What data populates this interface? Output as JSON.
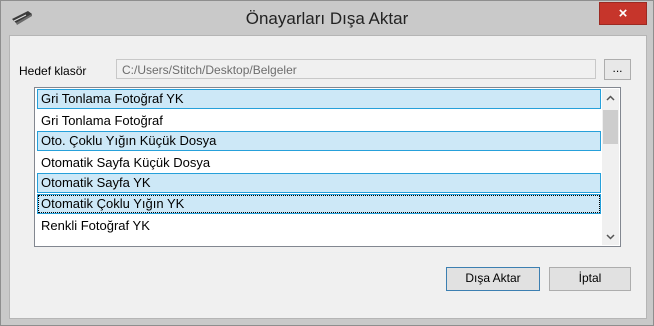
{
  "window": {
    "title": "Önayarları Dışa Aktar",
    "close_label": "×",
    "accent_close": "#c6352b"
  },
  "folder": {
    "label": "Hedef klasör",
    "path": "C:/Users/Stitch/Desktop/Belgeler",
    "browse_label": "..."
  },
  "presets": {
    "items": [
      {
        "label": "Gri Tonlama Fotoğraf YK",
        "selected": true
      },
      {
        "label": "Gri Tonlama Fotoğraf",
        "selected": false
      },
      {
        "label": "Oto. Çoklu Yığın Küçük Dosya",
        "selected": true
      },
      {
        "label": "Otomatik Sayfa Küçük Dosya",
        "selected": false
      },
      {
        "label": "Otomatik Sayfa YK",
        "selected": true
      },
      {
        "label": "Otomatik Çoklu Yığın YK",
        "selected": true,
        "focused": true
      },
      {
        "label": "Renkli Fotoğraf YK",
        "selected": false
      }
    ]
  },
  "buttons": {
    "export_label": "Dışa Aktar",
    "cancel_label": "İptal"
  }
}
